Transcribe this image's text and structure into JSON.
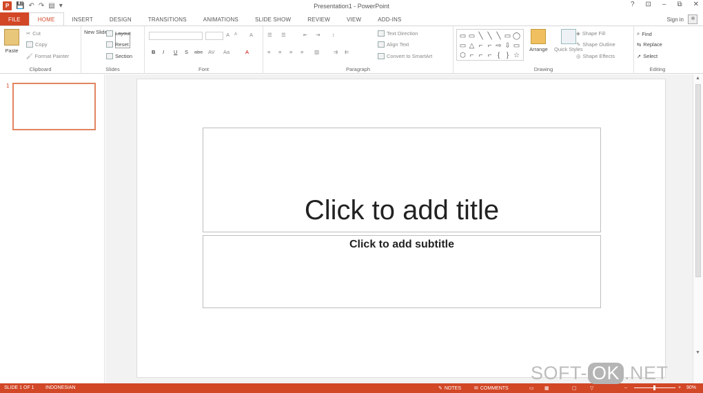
{
  "window": {
    "title": "Presentation1 - PowerPoint",
    "controls": [
      "?",
      "⊡",
      "–",
      "⧉",
      "✕"
    ],
    "app_icon_letter": "P",
    "qat": [
      "💾",
      "↶",
      "↷",
      "▤",
      "▾"
    ]
  },
  "tabs": [
    "FILE",
    "HOME",
    "INSERT",
    "DESIGN",
    "TRANSITIONS",
    "ANIMATIONS",
    "SLIDE SHOW",
    "REVIEW",
    "VIEW",
    "ADD-INS"
  ],
  "active_tab": "HOME",
  "signin": "Sign in",
  "ribbon": {
    "clipboard": {
      "label": "Clipboard",
      "paste": "Paste",
      "cut": "Cut",
      "copy": "Copy",
      "format_painter": "Format Painter"
    },
    "slides": {
      "label": "Slides",
      "new_slide": "New Slide",
      "layout": "Layout",
      "reset": "Reset",
      "section": "Section"
    },
    "font": {
      "label": "Font",
      "bold": "B",
      "italic": "I",
      "underline": "U",
      "shadow": "S",
      "strike": "abc",
      "spacing": "AV",
      "case": "Aa",
      "grow": "A",
      "shrink": "A",
      "clear": "A",
      "color": "A"
    },
    "paragraph": {
      "label": "Paragraph",
      "text_direction": "Text Direction",
      "align_text": "Align Text",
      "convert_smartart": "Convert to SmartArt"
    },
    "drawing": {
      "label": "Drawing",
      "arrange": "Arrange",
      "quick_styles": "Quick Styles",
      "shape_fill": "Shape Fill",
      "shape_outline": "Shape Outline",
      "shape_effects": "Shape Effects",
      "shapes": [
        "▭",
        "▭",
        "╲",
        "╲",
        "╲",
        "▭",
        "◯",
        "▭",
        "△",
        "⌐",
        "⌐",
        "⇨",
        "⇩",
        "▭",
        "⬡",
        "⌐",
        "⌐",
        "⌐",
        "{",
        "}",
        "☆"
      ]
    },
    "editing": {
      "label": "Editing",
      "find": "Find",
      "replace": "Replace",
      "select": "Select"
    }
  },
  "thumbnails": [
    {
      "number": "1"
    }
  ],
  "slide": {
    "title_placeholder": "Click to add title",
    "subtitle_placeholder": "Click to add subtitle"
  },
  "status": {
    "slide_count": "SLIDE 1 OF 1",
    "language": "INDONESIAN",
    "notes": "NOTES",
    "comments": "COMMENTS",
    "zoom": "90%"
  },
  "watermark": {
    "left": "SOFT-",
    "ok": "OK",
    "right": ".NET"
  },
  "colors": {
    "accent": "#d24726",
    "thumb_border": "#e2845f"
  }
}
